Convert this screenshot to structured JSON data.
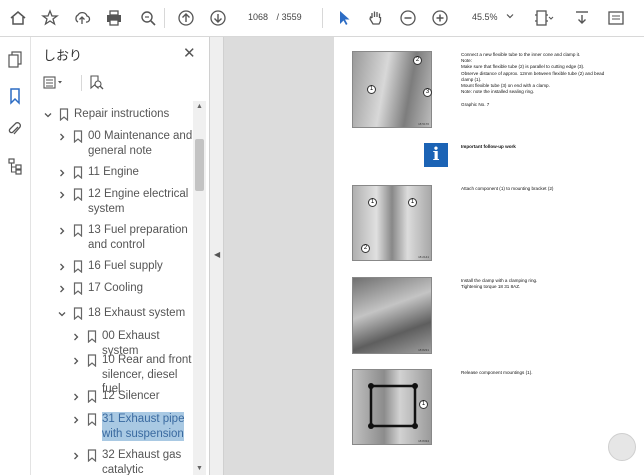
{
  "toolbar": {
    "page_current": "1068",
    "page_total": "3559",
    "page_separator": "/",
    "zoom": "45.5%"
  },
  "panel": {
    "title": "しおり",
    "close_glyph": "✕"
  },
  "tree": [
    {
      "label_lines": [
        "Repair instructions"
      ],
      "expanded": true
    },
    {
      "label_lines": [
        "00 Maintenance and",
        "general note"
      ]
    },
    {
      "label_lines": [
        "11 Engine"
      ]
    },
    {
      "label_lines": [
        "12 Engine electrical",
        "system"
      ]
    },
    {
      "label_lines": [
        "13 Fuel preparation",
        "and control"
      ]
    },
    {
      "label_lines": [
        "16 Fuel supply"
      ]
    },
    {
      "label_lines": [
        "17 Cooling"
      ]
    },
    {
      "label_lines": [
        "18 Exhaust system"
      ],
      "expanded": true
    },
    {
      "label_lines": [
        "00 Exhaust system"
      ]
    },
    {
      "label_lines": [
        "10 Rear and front",
        "silencer, diesel fuel"
      ]
    },
    {
      "label_lines": [
        "12 Silencer"
      ]
    },
    {
      "label_lines": [
        "31 Exhaust pipe",
        "with suspension"
      ],
      "selected": true
    },
    {
      "label_lines": [
        "32 Exhaust gas",
        "catalytic converter"
      ]
    }
  ],
  "document": {
    "block1": [
      "Connect a new flexible tube to the inner cone and clamp it.",
      "Note:",
      "Make sure that flexible tube (2) is parallel to cutting edge (3).",
      "Observe distance of approx. 12mm between flexible tube (2) and bead",
      "clamp (1).",
      "Mount flexible tube (3) on end with a clamp.",
      "Note: note the installed sealing ring.",
      "",
      "Graphic No. 7"
    ],
    "info_label": "Important follow-up work",
    "block3": [
      "Attach component (1) to mounting bracket (2)"
    ],
    "block4": [
      "Install the clamp with a clamping ring.",
      "Tightening torque 18 31 8AZ."
    ],
    "block5": [
      "Release component mountings (1)."
    ],
    "fig_refs": [
      "18 5170",
      "18 2141",
      "18 8231",
      "18 8334"
    ],
    "callouts": [
      "1",
      "2",
      "3"
    ],
    "info_glyph": "i"
  },
  "icons": {
    "home": "home-icon",
    "bookmark_add": "bookmark-star-icon",
    "upload": "upload-cloud-icon",
    "print": "print-icon",
    "search": "search-icon",
    "prev": "page-up-icon",
    "next": "page-down-icon",
    "select": "select-arrow-icon",
    "hand": "hand-icon",
    "zoom_out": "zoom-out-icon",
    "zoom_in": "zoom-in-icon",
    "fit": "fit-page-icon",
    "download": "download-icon",
    "more": "more-icon"
  },
  "colors": {
    "accent": "#3a78c8",
    "selected_row": "#a9c9e3",
    "info_blue": "#1b63b5"
  }
}
